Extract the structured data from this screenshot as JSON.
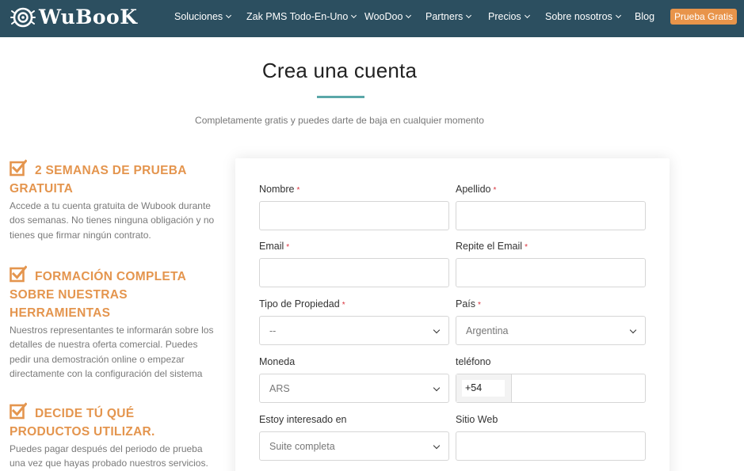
{
  "header": {
    "logo_text": "WuBooK",
    "nav": [
      {
        "label": "Soluciones",
        "dropdown": true
      },
      {
        "label": "Zak PMS Todo-En-Uno",
        "dropdown": true
      },
      {
        "label": "WooDoo",
        "dropdown": true
      },
      {
        "label": "Partners",
        "dropdown": true
      },
      {
        "label": "Precios",
        "dropdown": true
      },
      {
        "label": "Sobre nosotros",
        "dropdown": true
      },
      {
        "label": "Blog",
        "dropdown": false
      }
    ],
    "cta_label": "Prueba Gratis",
    "colors": {
      "bar": "#2c4f60",
      "cta": "#e8944a"
    }
  },
  "main": {
    "title": "Crea una cuenta",
    "subtitle": "Completamente gratis y puedes darte de baja en cualquier momento"
  },
  "features": [
    {
      "icon": "checkbox-icon",
      "title_lines": [
        "2 SEMANAS DE PRUEBA",
        "GRATUITA"
      ],
      "text_lines": [
        "Accede a tu cuenta gratuita de Wubook durante",
        "dos semanas. No tienes ninguna obligación y no",
        "tienes que firmar ningún contrato."
      ]
    },
    {
      "icon": "checkbox-icon",
      "title_lines": [
        "FORMACIÓN COMPLETA",
        "SOBRE NUESTRAS",
        "HERRAMIENTAS"
      ],
      "text_lines": [
        "Nuestros representantes te informarán sobre los",
        "detalles de nuestra oferta comercial. Puedes",
        "pedir una demostración online o empezar",
        "directamente con la configuración del sistema"
      ]
    },
    {
      "icon": "checkbox-icon",
      "title_lines": [
        "DECIDE TÚ QUÉ",
        "PRODUCTOS UTILIZAR."
      ],
      "text_lines": [
        "Puedes pagar después del periodo de prueba",
        "una vez que hayas probado nuestros servicios."
      ]
    }
  ],
  "form": {
    "nombre": {
      "label": "Nombre",
      "required_mark": "*",
      "value": ""
    },
    "apellido": {
      "label": "Apellido",
      "required_mark": "*",
      "value": ""
    },
    "email": {
      "label": "Email",
      "required_mark": "*",
      "value": ""
    },
    "repite_email": {
      "label": "Repite el Email",
      "required_mark": "*",
      "value": ""
    },
    "tipo_propiedad": {
      "label": "Tipo de Propiedad",
      "required_mark": "*",
      "selected": "--"
    },
    "pais": {
      "label": "País",
      "required_mark": "*",
      "selected": "Argentina"
    },
    "moneda": {
      "label": "Moneda",
      "selected": "ARS"
    },
    "telefono": {
      "label": "teléfono",
      "prefix": "+54",
      "value": ""
    },
    "interes": {
      "label": "Estoy interesado en",
      "selected": "Suite completa"
    },
    "sitio_web": {
      "label": "Sitio Web",
      "value": ""
    }
  }
}
